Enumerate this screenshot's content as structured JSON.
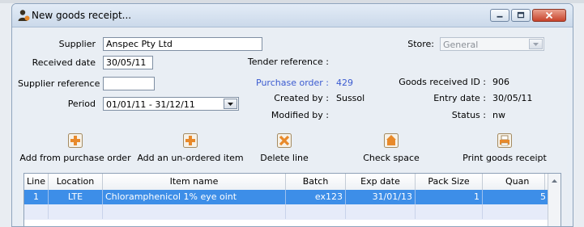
{
  "window": {
    "title": "New goods receipt..."
  },
  "form": {
    "supplier_label": "Supplier",
    "supplier_value": "Anspec Pty Ltd",
    "received_date_label": "Received date",
    "received_date_value": "30/05/11",
    "supplier_reference_label": "Supplier reference",
    "supplier_reference_value": "",
    "period_label": "Period",
    "period_value": "01/01/11 - 31/12/11",
    "tender_reference_label": "Tender reference :",
    "purchase_order_label": "Purchase order :",
    "purchase_order_value": "429",
    "created_by_label": "Created by :",
    "created_by_value": "Sussol",
    "modified_by_label": "Modified by :",
    "modified_by_value": "",
    "store_label": "Store:",
    "store_value": "General",
    "goods_received_id_label": "Goods received ID :",
    "goods_received_id_value": "906",
    "entry_date_label": "Entry date :",
    "entry_date_value": "30/05/11",
    "status_label": "Status :",
    "status_value": "nw"
  },
  "toolbar": {
    "add_from_po": "Add from purchase order",
    "add_unordered": "Add an un-ordered item",
    "delete_line": "Delete line",
    "check_space": "Check space",
    "print_receipt": "Print goods receipt",
    "icons": [
      "add-icon",
      "add-icon",
      "delete-icon",
      "check-space-icon",
      "print-icon"
    ]
  },
  "table": {
    "columns": [
      "Line",
      "Location",
      "Item name",
      "Batch",
      "Exp date",
      "Pack Size",
      "Quan"
    ],
    "rows": [
      [
        "1",
        "LTE",
        "Chloramphenicol 1% eye oint",
        "ex123",
        "31/01/13",
        "1",
        "5"
      ]
    ]
  },
  "colors": {
    "selection": "#3d8ee8",
    "link_blue": "#3b5bd0",
    "icon_orange": "#e8892a",
    "close_button": "#c8432b"
  }
}
